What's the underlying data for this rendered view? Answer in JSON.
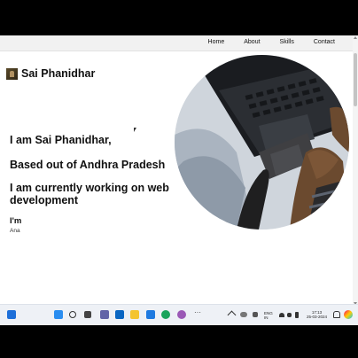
{
  "nav": {
    "links": [
      "Home",
      "About",
      "Skills",
      "Contact"
    ]
  },
  "brand": {
    "name": "Sai Phanidhar"
  },
  "hero": {
    "line1": "I am Sai Phanidhar,",
    "line2": "Based out of Andhra Pradesh",
    "line3": "I am currently working on web development",
    "im": "I'm",
    "role": "Ana"
  },
  "taskbar": {
    "language_top": "ENG",
    "language_bottom": "IN",
    "time": "17:13",
    "date": "25-03-2024"
  },
  "colors": {
    "page_bg": "#ffffff",
    "navbar_bg": "#f1f1f1",
    "taskbar_bg": "#eef1f6",
    "text": "#111111"
  },
  "icons": [
    "brand-logo-icon",
    "widgets-icon",
    "windows-start-icon",
    "search-icon",
    "task-view-icon",
    "teams-icon",
    "mail-icon",
    "file-explorer-icon",
    "store-icon",
    "edge-icon",
    "chrome-icon",
    "more-apps-icon",
    "chevron-up-icon",
    "wifi-icon",
    "speaker-icon",
    "battery-icon",
    "notification-icon",
    "copilot-icon"
  ]
}
